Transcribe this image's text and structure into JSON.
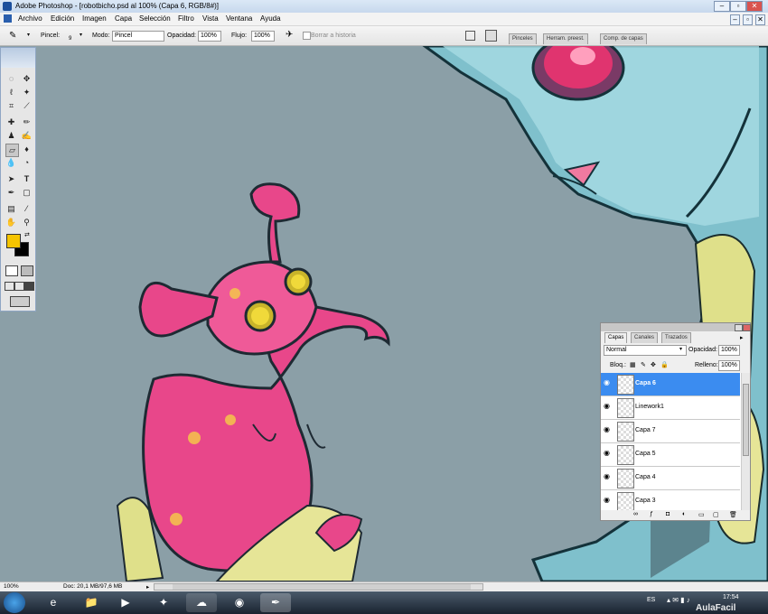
{
  "window": {
    "title": "Adobe Photoshop - [robotbicho.psd al 100% (Capa 6, RGB/8#)]"
  },
  "menu": [
    "Archivo",
    "Edición",
    "Imagen",
    "Capa",
    "Selección",
    "Filtro",
    "Vista",
    "Ventana",
    "Ayuda"
  ],
  "options": {
    "brush_label": "Pincel:",
    "brush_size": "9",
    "mode_label": "Modo:",
    "mode_value": "Pincel",
    "opacity_label": "Opacidad:",
    "opacity_value": "100%",
    "flow_label": "Flujo:",
    "flow_value": "100%",
    "history_label": "Borrar a historia",
    "tabs": [
      "Pinceles",
      "Herram. preest.",
      "Comp. de capas"
    ]
  },
  "tools": [
    "marquee",
    "move",
    "lasso",
    "magic-wand",
    "crop",
    "slice",
    "heal",
    "brush",
    "stamp",
    "history-brush",
    "eraser",
    "bucket",
    "blur",
    "dodge",
    "path-select",
    "type",
    "pen",
    "shape",
    "notes",
    "eyedropper",
    "hand",
    "zoom"
  ],
  "colors": {
    "foreground": "#f5c400",
    "background": "#000000",
    "canvas": "#8b9fa7",
    "selection": "#3b8cf0"
  },
  "layers_panel": {
    "tabs": [
      "Capas",
      "Canales",
      "Trazados"
    ],
    "blend_mode": "Normal",
    "opacity_label": "Opacidad:",
    "opacity_value": "100%",
    "lock_label": "Bloq.:",
    "fill_label": "Relleno:",
    "fill_value": "100%",
    "layers": [
      {
        "name": "Capa 6",
        "selected": true
      },
      {
        "name": "Linework1",
        "selected": false
      },
      {
        "name": "Capa 7",
        "selected": false
      },
      {
        "name": "Capa 5",
        "selected": false
      },
      {
        "name": "Capa 4",
        "selected": false
      },
      {
        "name": "Capa 3",
        "selected": false
      }
    ]
  },
  "status": {
    "zoom": "100%",
    "doc": "Doc: 20,1 MB/97,6 MB"
  },
  "taskbar": {
    "lang": "ES",
    "time": "17:54",
    "watermark": "AulaFacil"
  }
}
